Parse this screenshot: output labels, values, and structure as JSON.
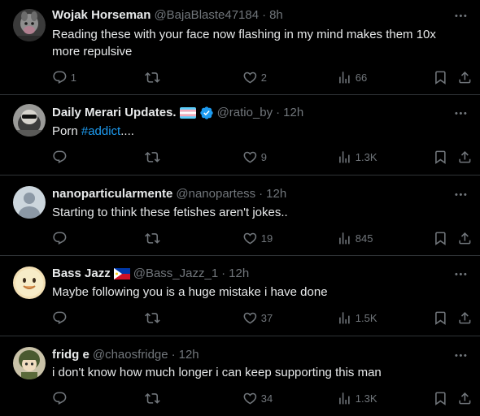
{
  "tweets": [
    {
      "name": "Wojak Horseman",
      "handle": "@BajaBlaste47184",
      "time": "8h",
      "text": "Reading these with your face now flashing in my mind makes them 10x more repulsive",
      "replies": "1",
      "retweets": "",
      "likes": "2",
      "views": "66",
      "avatar": "wojak-avatar"
    },
    {
      "name": "Daily Merari Updates.",
      "handle": "@ratio_by",
      "time": "12h",
      "text_prefix": "Porn ",
      "hashtag": "#addict",
      "text_suffix": "....",
      "replies": "",
      "retweets": "",
      "likes": "9",
      "views": "1.3K",
      "avatar": "sunglasses-avatar",
      "flag": "transgender-flag",
      "verified": true
    },
    {
      "name": "nanoparticularmente",
      "handle": "@nanopartess",
      "time": "12h",
      "text": "Starting to think these fetishes aren't jokes..",
      "replies": "",
      "retweets": "",
      "likes": "19",
      "views": "845",
      "avatar": "default-avatar"
    },
    {
      "name": "Bass Jazz",
      "handle": "@Bass_Jazz_1",
      "time": "12h",
      "text": "Maybe following you is a huge mistake i have done",
      "replies": "",
      "retweets": "",
      "likes": "37",
      "views": "1.5K",
      "avatar": "smiley-avatar",
      "flag": "philippines-flag"
    },
    {
      "name": "fridg e",
      "handle": "@chaosfridge",
      "time": "12h",
      "text": "i don't know how much longer i can keep supporting this man",
      "replies": "",
      "retweets": "",
      "likes": "34",
      "views": "1.3K",
      "avatar": "anime-avatar"
    }
  ],
  "separator": "·",
  "colors": {
    "background": "#000000",
    "text": "#e7e9ea",
    "secondary": "#71767b",
    "accent": "#1d9bf0",
    "border": "#2f3336"
  }
}
